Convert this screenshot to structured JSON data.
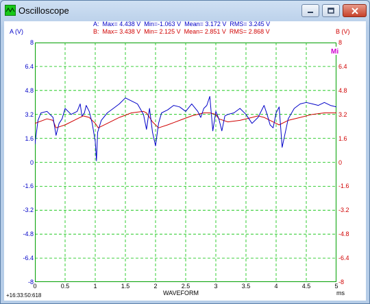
{
  "window": {
    "title": "Oscilloscope"
  },
  "stats": {
    "a": "A:  Max= 4.438 V  Min=-1.063 V  Mean= 3.172 V  RMS= 3.245 V",
    "b": "B:  Max= 3.438 V  Min= 2.125 V  Mean= 2.851 V  RMS= 2.868 V"
  },
  "axes": {
    "left_title": "A (V)",
    "right_title": "B (V)",
    "y_ticks": [
      "8",
      "6.4",
      "4.8",
      "3.2",
      "1.6",
      "0",
      "-1.6",
      "-3.2",
      "-4.8",
      "-6.4",
      "-8"
    ],
    "x_ticks": [
      "0",
      "0.5",
      "1",
      "1.5",
      "2",
      "2.5",
      "3",
      "3.5",
      "4",
      "4.5",
      "5"
    ],
    "x_title": "WAVEFORM",
    "x_unit": "ms"
  },
  "timestamp": "+16:33:50:618",
  "trigger_icon": "trigger-mi-icon",
  "colors": {
    "channel_a": "#0000c8",
    "channel_b": "#d00000",
    "grid": "#00c000",
    "border": "#00a000"
  },
  "chart_data": {
    "type": "line",
    "xlabel": "WAVEFORM",
    "ylabel": "A (V)",
    "y2label": "B (V)",
    "xlim": [
      0,
      5
    ],
    "ylim": [
      -8,
      8
    ],
    "grid": true,
    "series": [
      {
        "name": "A",
        "x": [
          0,
          0.05,
          0.1,
          0.2,
          0.3,
          0.35,
          0.4,
          0.45,
          0.5,
          0.6,
          0.7,
          0.75,
          0.78,
          0.82,
          0.85,
          0.9,
          0.95,
          1.0,
          1.02,
          1.04,
          1.1,
          1.2,
          1.3,
          1.4,
          1.5,
          1.6,
          1.7,
          1.8,
          1.85,
          1.9,
          1.95,
          2.0,
          2.05,
          2.1,
          2.2,
          2.3,
          2.4,
          2.5,
          2.6,
          2.7,
          2.75,
          2.8,
          2.85,
          2.9,
          2.95,
          3.0,
          3.05,
          3.1,
          3.15,
          3.2,
          3.3,
          3.4,
          3.5,
          3.6,
          3.7,
          3.8,
          3.85,
          3.9,
          3.95,
          4.0,
          4.05,
          4.1,
          4.2,
          4.3,
          4.4,
          4.5,
          4.6,
          4.7,
          4.8,
          4.9,
          5.0
        ],
        "values": [
          1.2,
          2.8,
          3.3,
          3.4,
          3.0,
          1.8,
          2.6,
          2.9,
          3.6,
          3.2,
          3.4,
          3.9,
          3.1,
          3.3,
          3.8,
          3.4,
          2.6,
          1.4,
          0.1,
          2.0,
          2.8,
          3.3,
          3.6,
          3.9,
          4.3,
          4.1,
          3.9,
          3.2,
          2.2,
          3.6,
          2.0,
          1.1,
          2.6,
          3.3,
          3.5,
          3.8,
          3.7,
          3.4,
          3.9,
          3.4,
          3.0,
          3.6,
          3.8,
          4.4,
          2.1,
          3.4,
          2.9,
          2.1,
          3.1,
          3.2,
          3.3,
          3.6,
          3.2,
          2.6,
          3.0,
          3.8,
          3.2,
          2.5,
          2.3,
          3.3,
          3.7,
          1.0,
          2.9,
          3.6,
          3.9,
          4.0,
          3.9,
          3.8,
          4.0,
          3.8,
          3.7
        ]
      },
      {
        "name": "B",
        "x": [
          0,
          0.2,
          0.3,
          0.35,
          0.5,
          0.7,
          0.8,
          0.9,
          1.0,
          1.05,
          1.2,
          1.4,
          1.6,
          1.8,
          1.85,
          1.95,
          2.05,
          2.2,
          2.4,
          2.6,
          2.8,
          2.9,
          3.0,
          3.05,
          3.2,
          3.4,
          3.6,
          3.7,
          3.8,
          3.9,
          4.0,
          4.05,
          4.2,
          4.4,
          4.6,
          4.8,
          5.0
        ],
        "values": [
          2.6,
          2.9,
          2.8,
          2.3,
          2.5,
          2.9,
          3.1,
          3.0,
          2.6,
          2.3,
          2.6,
          3.0,
          3.3,
          3.4,
          3.3,
          2.7,
          2.3,
          2.5,
          2.8,
          3.1,
          3.3,
          3.3,
          3.2,
          2.9,
          2.7,
          2.8,
          3.0,
          3.1,
          3.0,
          2.8,
          2.6,
          2.5,
          2.8,
          3.0,
          3.2,
          3.3,
          3.3
        ]
      }
    ]
  }
}
